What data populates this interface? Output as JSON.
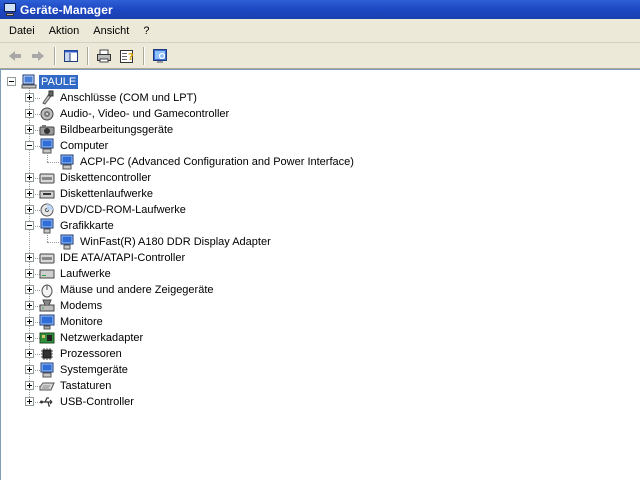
{
  "window": {
    "title": "Geräte-Manager"
  },
  "menu": [
    "Datei",
    "Aktion",
    "Ansicht",
    "?"
  ],
  "toolbar": {
    "buttons": [
      "back-arrow-icon",
      "forward-arrow-icon",
      "show-hide-console-tree-icon",
      "print-icon",
      "help-properties-icon",
      "scan-hardware-icon"
    ]
  },
  "tree": {
    "root": "PAULE",
    "categories": [
      {
        "label": "Anschlüsse (COM und LPT)",
        "icon": "port-icon",
        "expanded": false
      },
      {
        "label": "Audio-, Video- und Gamecontroller",
        "icon": "speaker-icon",
        "expanded": false
      },
      {
        "label": "Bildbearbeitungsgeräte",
        "icon": "camera-icon",
        "expanded": false
      },
      {
        "label": "Computer",
        "icon": "computer-icon",
        "expanded": true,
        "children": [
          "ACPI-PC (Advanced Configuration and Power Interface)"
        ]
      },
      {
        "label": "Diskettencontroller",
        "icon": "disk-controller-icon",
        "expanded": false
      },
      {
        "label": "Diskettenlaufwerke",
        "icon": "floppy-drive-icon",
        "expanded": false
      },
      {
        "label": "DVD/CD-ROM-Laufwerke",
        "icon": "cdrom-icon",
        "expanded": false
      },
      {
        "label": "Grafikkarte",
        "icon": "display-adapter-icon",
        "expanded": true,
        "children": [
          "WinFast(R) A180 DDR Display Adapter"
        ]
      },
      {
        "label": "IDE ATA/ATAPI-Controller",
        "icon": "ide-controller-icon",
        "expanded": false
      },
      {
        "label": "Laufwerke",
        "icon": "drive-icon",
        "expanded": false
      },
      {
        "label": "Mäuse und andere Zeigegeräte",
        "icon": "mouse-icon",
        "expanded": false
      },
      {
        "label": "Modems",
        "icon": "modem-icon",
        "expanded": false
      },
      {
        "label": "Monitore",
        "icon": "monitor-icon",
        "expanded": false
      },
      {
        "label": "Netzwerkadapter",
        "icon": "network-adapter-icon",
        "expanded": false
      },
      {
        "label": "Prozessoren",
        "icon": "processor-icon",
        "expanded": false
      },
      {
        "label": "Systemgeräte",
        "icon": "system-device-icon",
        "expanded": false
      },
      {
        "label": "Tastaturen",
        "icon": "keyboard-icon",
        "expanded": false
      },
      {
        "label": "USB-Controller",
        "icon": "usb-icon",
        "expanded": false
      }
    ]
  },
  "colors": {
    "title_bar": "#1d48c3",
    "menu_bg": "#ece9d8",
    "selection": "#316ac5"
  }
}
